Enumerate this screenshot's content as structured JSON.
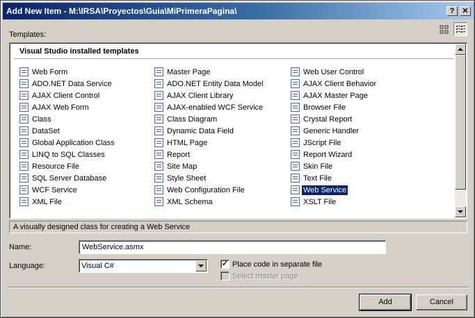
{
  "window": {
    "title": "Add New Item - M:\\IRSA\\Proyectos\\Guia\\MiPrimeraPagina\\",
    "help_glyph": "?",
    "close_glyph": "✕"
  },
  "templates": {
    "label": "Templates:",
    "group_header": "Visual Studio installed templates",
    "columns": [
      [
        {
          "label": "Web Form",
          "icon": "web-form-icon"
        },
        {
          "label": "ADO.NET Data Service",
          "icon": "data-service-icon"
        },
        {
          "label": "AJAX Client Control",
          "icon": "ajax-control-icon"
        },
        {
          "label": "AJAX Web Form",
          "icon": "ajax-form-icon"
        },
        {
          "label": "Class",
          "icon": "class-icon"
        },
        {
          "label": "DataSet",
          "icon": "dataset-icon"
        },
        {
          "label": "Global Application Class",
          "icon": "global-class-icon"
        },
        {
          "label": "LINQ to SQL Classes",
          "icon": "linq-icon"
        },
        {
          "label": "Resource File",
          "icon": "resource-icon"
        },
        {
          "label": "SQL Server Database",
          "icon": "database-icon"
        },
        {
          "label": "WCF Service",
          "icon": "wcf-icon"
        },
        {
          "label": "XML File",
          "icon": "xml-icon"
        }
      ],
      [
        {
          "label": "Master Page",
          "icon": "master-page-icon"
        },
        {
          "label": "ADO.NET Entity Data Model",
          "icon": "entity-model-icon"
        },
        {
          "label": "AJAX Client Library",
          "icon": "ajax-library-icon"
        },
        {
          "label": "AJAX-enabled WCF Service",
          "icon": "ajax-wcf-icon"
        },
        {
          "label": "Class Diagram",
          "icon": "class-diagram-icon"
        },
        {
          "label": "Dynamic Data Field",
          "icon": "dynamic-data-icon"
        },
        {
          "label": "HTML Page",
          "icon": "html-page-icon"
        },
        {
          "label": "Report",
          "icon": "report-icon"
        },
        {
          "label": "Site Map",
          "icon": "site-map-icon"
        },
        {
          "label": "Style Sheet",
          "icon": "style-sheet-icon"
        },
        {
          "label": "Web Configuration File",
          "icon": "web-config-icon"
        },
        {
          "label": "XML Schema",
          "icon": "xml-schema-icon"
        }
      ],
      [
        {
          "label": "Web User Control",
          "icon": "user-control-icon"
        },
        {
          "label": "AJAX Client Behavior",
          "icon": "ajax-behavior-icon"
        },
        {
          "label": "AJAX Master Page",
          "icon": "ajax-master-icon"
        },
        {
          "label": "Browser File",
          "icon": "browser-file-icon"
        },
        {
          "label": "Crystal Report",
          "icon": "crystal-report-icon"
        },
        {
          "label": "Generic Handler",
          "icon": "handler-icon"
        },
        {
          "label": "JScript File",
          "icon": "jscript-icon"
        },
        {
          "label": "Report Wizard",
          "icon": "report-wizard-icon"
        },
        {
          "label": "Skin File",
          "icon": "skin-file-icon"
        },
        {
          "label": "Text File",
          "icon": "text-file-icon"
        },
        {
          "label": "Web Service",
          "icon": "web-service-icon",
          "selected": true
        },
        {
          "label": "XSLT File",
          "icon": "xslt-icon"
        }
      ]
    ],
    "description": "A visually designed class for creating a Web Service"
  },
  "form": {
    "name_label": "Name:",
    "name_value": "WebService.asmx",
    "language_label": "Language:",
    "language_value": "Visual C#",
    "separate_code_label": "Place code in separate file",
    "separate_code_checked": true,
    "master_page_label": "Select master page",
    "master_page_checked": false
  },
  "buttons": {
    "add": "Add",
    "cancel": "Cancel"
  },
  "colors": {
    "selection": "#0a246a",
    "dialog_bg": "#d4d0c8"
  }
}
